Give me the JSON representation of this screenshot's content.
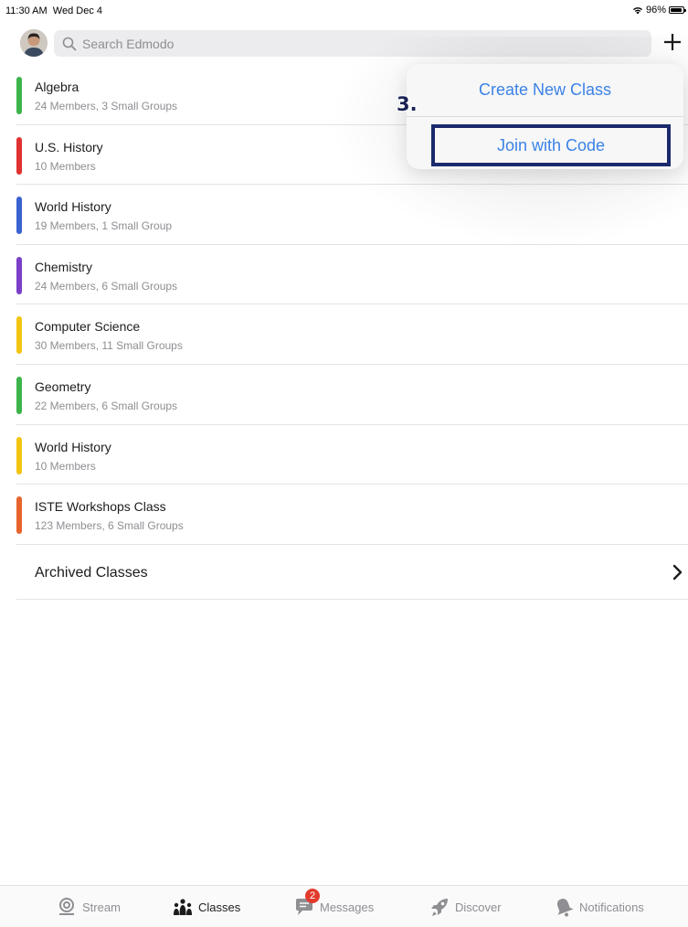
{
  "status_bar": {
    "time": "11:30 AM",
    "date": "Wed Dec 4",
    "battery": "96%",
    "battery_level": 0.96
  },
  "search": {
    "placeholder": "Search Edmodo"
  },
  "classes": [
    {
      "name": "Algebra",
      "meta": "24 Members, 3 Small Groups",
      "color": "#3cb44b"
    },
    {
      "name": "U.S. History",
      "meta": "10 Members",
      "color": "#e03131"
    },
    {
      "name": "World History",
      "meta": "19 Members, 1 Small Group",
      "color": "#3a63d1"
    },
    {
      "name": "Chemistry",
      "meta": "24 Members, 6 Small Groups",
      "color": "#7b3fc9"
    },
    {
      "name": "Computer Science",
      "meta": "30 Members, 11 Small Groups",
      "color": "#f2c413"
    },
    {
      "name": "Geometry",
      "meta": "22 Members, 6 Small Groups",
      "color": "#3cb44b"
    },
    {
      "name": "World History",
      "meta": "10 Members",
      "color": "#f2c413"
    },
    {
      "name": "ISTE Workshops Class",
      "meta": "123 Members, 6 Small Groups",
      "color": "#e8632c"
    }
  ],
  "archived": {
    "label": "Archived Classes"
  },
  "popover": {
    "create_label": "Create New Class",
    "join_label": "Join with Code",
    "step_label": "3."
  },
  "tabs": [
    {
      "label": "Stream",
      "icon": "stream-icon"
    },
    {
      "label": "Classes",
      "icon": "classes-icon",
      "active": true
    },
    {
      "label": "Messages",
      "icon": "messages-icon",
      "badge": "2"
    },
    {
      "label": "Discover",
      "icon": "discover-icon"
    },
    {
      "label": "Notifications",
      "icon": "notifications-icon"
    }
  ],
  "colors": {
    "accent": "#3b82e6",
    "highlight_border": "#1a2a6c",
    "badge": "#e23b2e"
  }
}
